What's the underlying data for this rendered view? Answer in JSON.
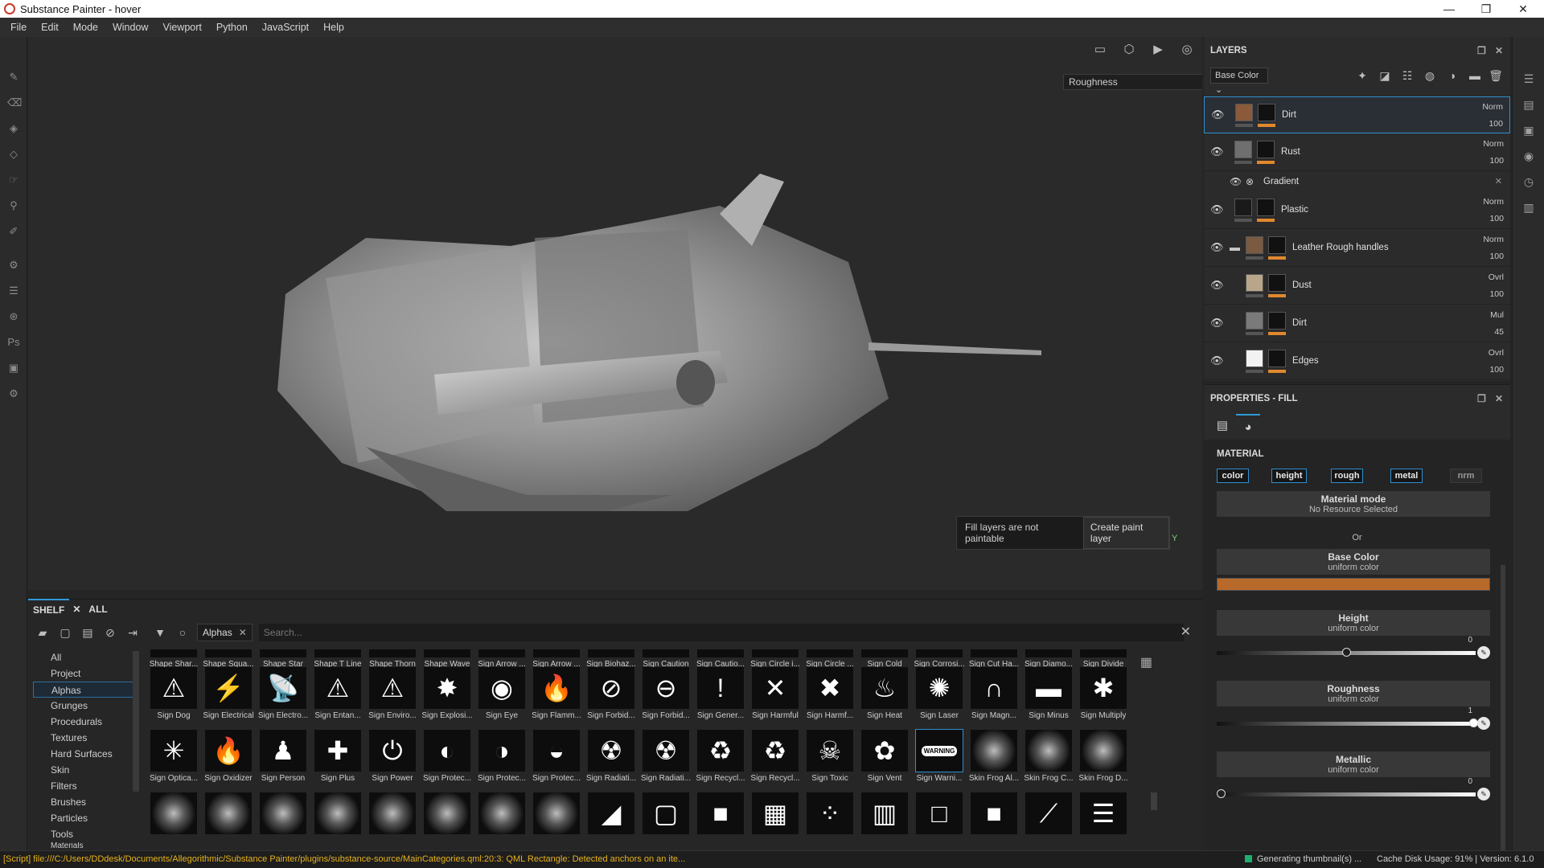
{
  "window": {
    "title": "Substance Painter - hover",
    "controls": {
      "minimize": "—",
      "restore": "❐",
      "close": "✕"
    }
  },
  "menu": [
    "File",
    "Edit",
    "Mode",
    "Window",
    "Viewport",
    "Python",
    "JavaScript",
    "Help"
  ],
  "viewport": {
    "channel_select": "Roughness",
    "axis_label": "Y",
    "notice_text": "Fill layers are not paintable",
    "notice_button": "Create paint layer"
  },
  "shelf": {
    "tabs": [
      "SHELF",
      "ALL"
    ],
    "tab_close": "✕",
    "filter_chip": "Alphas",
    "filter_chip_close": "✕",
    "search_placeholder": "Search...",
    "close": "✕",
    "categories": [
      "All",
      "Project",
      "Alphas",
      "Grunges",
      "Procedurals",
      "Textures",
      "Hard Surfaces",
      "Skin",
      "Filters",
      "Brushes",
      "Particles",
      "Tools",
      "Materials"
    ],
    "selected_category": "Alphas",
    "row0": [
      "Shape Shar...",
      "Shape Squa...",
      "Shape Star",
      "Shape T Line",
      "Shape Thorn",
      "Shape Wave",
      "Sign Arrow ...",
      "Sign Arrow ...",
      "Sign Biohaz...",
      "Sign Caution",
      "Sign Cautio...",
      "Sign Circle i...",
      "Sign Circle ...",
      "Sign Cold",
      "Sign Corrosi...",
      "Sign Cut Ha...",
      "Sign Diamo...",
      "Sign Divide"
    ],
    "row1": [
      "Sign Dog",
      "Sign Electrical",
      "Sign Electro...",
      "Sign Entan...",
      "Sign Enviro...",
      "Sign Explosi...",
      "Sign Eye",
      "Sign Flamm...",
      "Sign Forbid...",
      "Sign Forbid...",
      "Sign Gener...",
      "Sign Harmful",
      "Sign Harmf...",
      "Sign Heat",
      "Sign Laser",
      "Sign Magn...",
      "Sign Minus",
      "Sign Multiply"
    ],
    "row2": [
      "Sign Optica...",
      "Sign Oxidizer",
      "Sign Person",
      "Sign Plus",
      "Sign Power",
      "Sign Protec...",
      "Sign Protec...",
      "Sign Protec...",
      "Sign Radiati...",
      "Sign Radiati...",
      "Sign Recycl...",
      "Sign Recycl...",
      "Sign Toxic",
      "Sign Vent",
      "Sign Warni...",
      "Skin Frog Al...",
      "Skin Frog C...",
      "Skin Frog D..."
    ],
    "row1_glyphs": [
      "⚠",
      "⚡",
      "📡",
      "⚠",
      "⚠",
      "✸",
      "◉",
      "🔥",
      "⊘",
      "⊖",
      "!",
      "✕",
      "✖",
      "♨",
      "✺",
      "∩",
      "▬",
      "✱"
    ],
    "row2_glyphs": [
      "✳",
      "🔥",
      "♟",
      "✚",
      "⏻",
      "◐",
      "◑",
      "◒",
      "☢",
      "☢",
      "♻",
      "♻",
      "☠",
      "✿",
      "WARNING",
      "",
      "",
      ""
    ],
    "row3_glyphs": [
      "",
      "",
      "",
      "",
      "",
      "",
      "",
      "",
      "◢",
      "▢",
      "■",
      "▦",
      "⁘",
      "▥",
      "□",
      "■",
      "⟋",
      "☰"
    ],
    "selected_tile": "Sign Warni..."
  },
  "layers": {
    "title": "LAYERS",
    "channel": "Base Color",
    "items": [
      {
        "name": "Dirt",
        "blend": "Norm",
        "opacity": "100",
        "swatch": "#8a5a3a",
        "selected": true
      },
      {
        "name": "Rust",
        "blend": "Norm",
        "opacity": "100",
        "swatch": "#6f6f6f"
      },
      {
        "name": "Plastic",
        "blend": "Norm",
        "opacity": "100",
        "swatch": "#1a1a1a"
      },
      {
        "name": "Leather Rough handles",
        "blend": "Norm",
        "opacity": "100",
        "swatch": "#7a5a40",
        "folder": true
      },
      {
        "name": "Dust",
        "blend": "Ovrl",
        "opacity": "100",
        "swatch": "#b9a68a"
      },
      {
        "name": "Dirt",
        "blend": "Mul",
        "opacity": "45",
        "swatch": "#7a7a7a"
      },
      {
        "name": "Edges",
        "blend": "Ovrl",
        "opacity": "100",
        "swatch": "#f2f2f2"
      }
    ],
    "sub_item": {
      "name": "Gradient",
      "close": "✕"
    }
  },
  "properties": {
    "title": "PROPERTIES - FILL",
    "section": "MATERIAL",
    "channels": [
      "color",
      "height",
      "rough",
      "metal",
      "nrm"
    ],
    "material_mode": {
      "title": "Material mode",
      "sub": "No Resource Selected"
    },
    "or_label": "Or",
    "base_color": {
      "title": "Base Color",
      "sub": "uniform color",
      "color": "#b86a2a"
    },
    "height": {
      "title": "Height",
      "sub": "uniform color",
      "value": "0"
    },
    "roughness": {
      "title": "Roughness",
      "sub": "uniform color",
      "value": "1"
    },
    "metallic": {
      "title": "Metallic",
      "sub": "uniform color",
      "value": "0"
    }
  },
  "status": {
    "log": "[Script] file:///C:/Users/DDdesk/Documents/Allegorithmic/Substance Painter/plugins/substance-source/MainCategories.qml:20:3: QML Rectangle: Detected anchors on an ite...",
    "generating": "Generating thumbnail(s) ...",
    "cache": "Cache Disk Usage:   91% | Version: 6.1.0"
  },
  "colors": {
    "accent": "#2f8fd0",
    "layer_bar": "#e0882e",
    "status_log": "#e7b21b"
  }
}
